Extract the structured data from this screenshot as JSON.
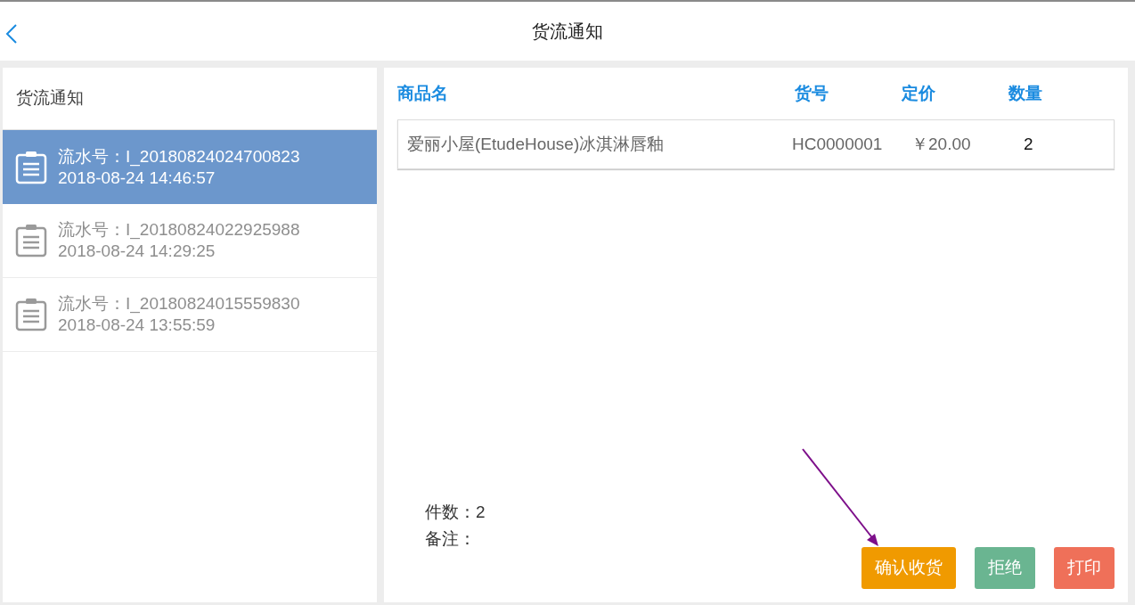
{
  "header": {
    "title": "货流通知"
  },
  "sidebar": {
    "title": "货流通知",
    "items": [
      {
        "serial": "流水号：I_20180824024700823",
        "time": "2018-08-24 14:46:57",
        "selected": true
      },
      {
        "serial": "流水号：I_20180824022925988",
        "time": "2018-08-24 14:29:25",
        "selected": false
      },
      {
        "serial": "流水号：I_20180824015559830",
        "time": "2018-08-24 13:55:59",
        "selected": false
      }
    ]
  },
  "table": {
    "columns": [
      "商品名",
      "货号",
      "定价",
      "数量"
    ],
    "rows": [
      [
        "爱丽小屋(EtudeHouse)冰淇淋唇釉",
        "HC0000001",
        "￥20.00",
        "2"
      ]
    ]
  },
  "summary": {
    "count": "件数：2",
    "note": "备注："
  },
  "buttons": [
    {
      "label": "确认收货",
      "color": "#f09a00"
    },
    {
      "label": "拒绝",
      "color": "#6ab591"
    },
    {
      "label": "打印",
      "color": "#ef7059"
    }
  ]
}
